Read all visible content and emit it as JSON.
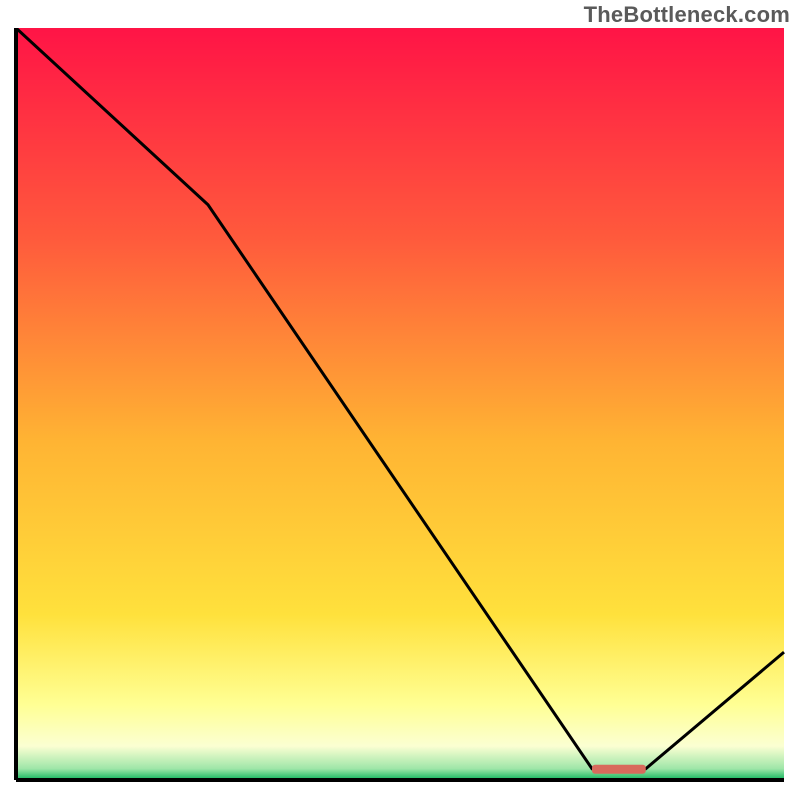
{
  "attribution": "TheBottleneck.com",
  "chart_data": {
    "type": "line",
    "title": "",
    "xlabel": "",
    "ylabel": "",
    "xlim": [
      0,
      100
    ],
    "ylim": [
      0,
      100
    ],
    "x": [
      0,
      25,
      75,
      82,
      100
    ],
    "values": [
      100,
      76.5,
      1.5,
      1.5,
      17
    ],
    "highlight_segment": {
      "x_start": 75,
      "x_end": 82,
      "y": 1.5
    },
    "background_gradient": {
      "stops": [
        {
          "offset": 0.0,
          "color": "#ff1446"
        },
        {
          "offset": 0.28,
          "color": "#ff5a3c"
        },
        {
          "offset": 0.55,
          "color": "#ffb433"
        },
        {
          "offset": 0.78,
          "color": "#ffe13c"
        },
        {
          "offset": 0.9,
          "color": "#ffff94"
        },
        {
          "offset": 0.955,
          "color": "#fbffd2"
        },
        {
          "offset": 0.985,
          "color": "#9ee6a8"
        },
        {
          "offset": 1.0,
          "color": "#0fb45c"
        }
      ]
    }
  }
}
